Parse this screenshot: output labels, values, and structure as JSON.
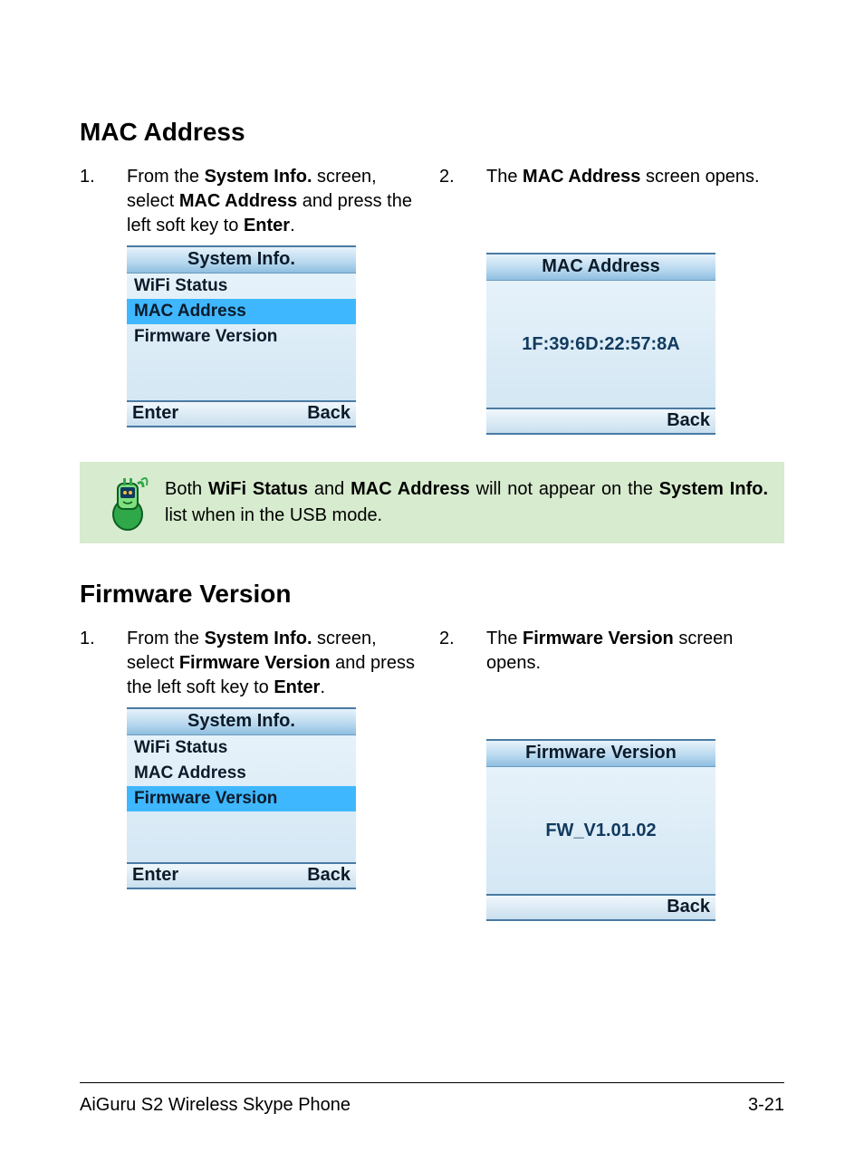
{
  "section1": {
    "heading": "MAC Address",
    "step1": {
      "num": "1.",
      "pre": "From the ",
      "b1": "System Info.",
      "mid1": " screen, select ",
      "b2": "MAC Address",
      "mid2": " and press the left soft key to ",
      "b3": "Enter",
      "post": "."
    },
    "step2": {
      "num": "2.",
      "pre": "The ",
      "b1": "MAC Address",
      "post": " screen opens."
    },
    "phone1": {
      "title": "System Info.",
      "items": [
        "WiFi Status",
        "MAC Address",
        "Firmware Version"
      ],
      "selectedIndex": 1,
      "softLeft": "Enter",
      "softRight": "Back"
    },
    "phone2": {
      "title": "MAC Address",
      "value": "1F:39:6D:22:57:8A",
      "softLeft": "",
      "softRight": "Back"
    }
  },
  "note": {
    "pre": "Both ",
    "b1": "WiFi Status",
    "mid1": " and ",
    "b2": "MAC Address",
    "mid2": " will not appear on the ",
    "b3": "System Info.",
    "post": " list when in the USB mode."
  },
  "section2": {
    "heading": "Firmware Version",
    "step1": {
      "num": "1.",
      "pre": "From the ",
      "b1": "System Info.",
      "mid1": " screen, select ",
      "b2": "Firmware Version",
      "mid2": " and press the left soft key to ",
      "b3": "Enter",
      "post": "."
    },
    "step2": {
      "num": "2.",
      "pre": "The ",
      "b1": "Firmware Version",
      "post": " screen opens."
    },
    "phone1": {
      "title": "System Info.",
      "items": [
        "WiFi Status",
        "MAC Address",
        "Firmware Version"
      ],
      "selectedIndex": 2,
      "softLeft": "Enter",
      "softRight": "Back"
    },
    "phone2": {
      "title": "Firmware Version",
      "value": "FW_V1.01.02",
      "softLeft": "",
      "softRight": "Back"
    }
  },
  "footer": {
    "left": "AiGuru S2 Wireless Skype Phone",
    "right": "3-21"
  }
}
